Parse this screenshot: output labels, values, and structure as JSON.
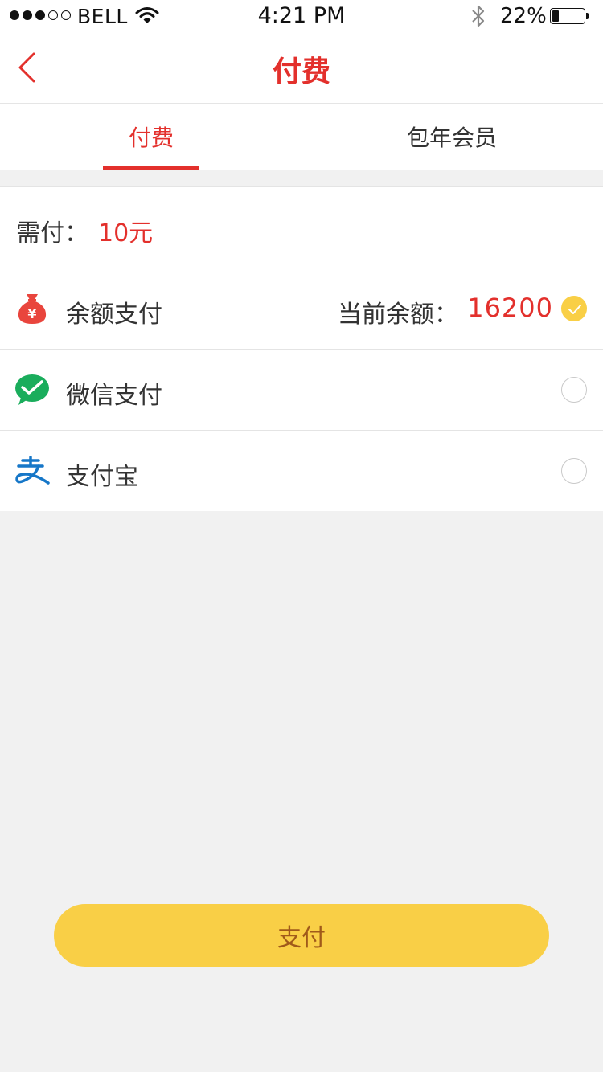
{
  "status_bar": {
    "carrier": "BELL",
    "time": "4:21 PM",
    "battery_percent": "22%",
    "battery_level": 0.22,
    "signal_bars_filled": 3,
    "signal_bars_total": 5
  },
  "nav": {
    "title": "付费",
    "back_icon": "chevron-left-icon"
  },
  "tabs": [
    {
      "label": "付费",
      "active": true
    },
    {
      "label": "包年会员",
      "active": false
    }
  ],
  "amount": {
    "label": "需付：",
    "value": "10元"
  },
  "payment_methods": [
    {
      "label": "余额支付",
      "icon": "money-bag-icon",
      "balance_label": "当前余额：",
      "balance_value": "16200",
      "selected": true
    },
    {
      "label": "微信支付",
      "icon": "wechat-icon",
      "selected": false
    },
    {
      "label": "支付宝",
      "icon": "alipay-icon",
      "selected": false
    }
  ],
  "pay_button": {
    "label": "支付"
  },
  "colors": {
    "accent_red": "#e3302c",
    "button_yellow": "#f9cf46",
    "button_text": "#a05a1a",
    "background": "#f1f1f1"
  }
}
